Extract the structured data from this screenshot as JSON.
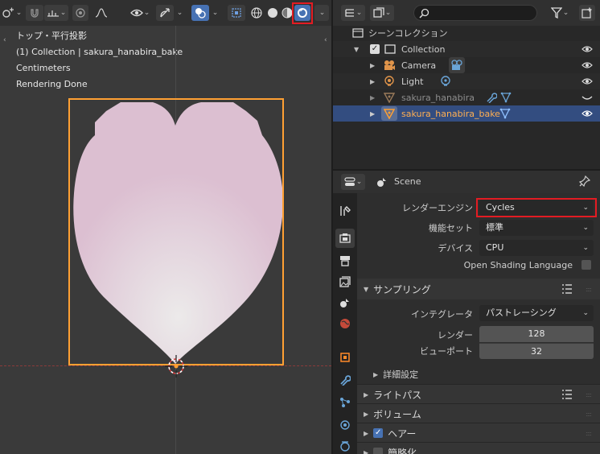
{
  "viewport": {
    "overlay": {
      "view_name": "トップ・平行投影",
      "collection_line": "(1) Collection | sakura_hanabira_bake",
      "units": "Centimeters",
      "status": "Rendering Done"
    }
  },
  "outliner": {
    "title": "シーンコレクション",
    "items": [
      {
        "label": "Collection"
      },
      {
        "label": "Camera"
      },
      {
        "label": "Light"
      },
      {
        "label": "sakura_hanabira"
      },
      {
        "label": "sakura_hanabira_bake"
      }
    ]
  },
  "properties": {
    "context": "Scene",
    "fields": {
      "render_engine": {
        "label": "レンダーエンジン",
        "value": "Cycles"
      },
      "feature_set": {
        "label": "機能セット",
        "value": "標準"
      },
      "device": {
        "label": "デバイス",
        "value": "CPU"
      },
      "osl": {
        "label": "Open Shading Language"
      }
    },
    "sampling": {
      "title": "サンプリング",
      "integrator": {
        "label": "インテグレータ",
        "value": "パストレーシング"
      },
      "render": {
        "label": "レンダー",
        "value": "128"
      },
      "viewport": {
        "label": "ビューポート",
        "value": "32"
      },
      "advanced": "詳細設定"
    },
    "panels": {
      "light_paths": "ライトパス",
      "volumes": "ボリューム",
      "hair": "ヘアー",
      "simplify": "簡略化"
    }
  },
  "colors": {
    "accent": "#4772b3",
    "highlight_box": "#e31c23",
    "selection": "#ffa033",
    "petal": "#ddc1d3"
  }
}
